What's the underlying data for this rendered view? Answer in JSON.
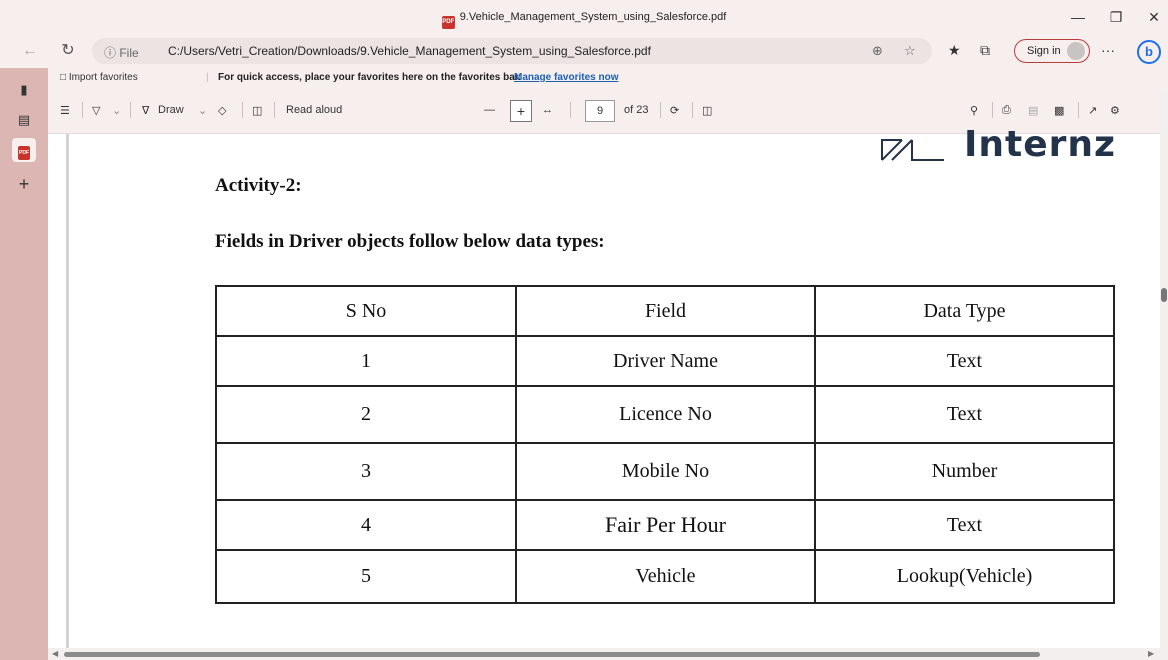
{
  "window": {
    "title": "9.Vehicle_Management_System_using_Salesforce.pdf",
    "pdf_badge": "PDF",
    "minimize_icon": "minimize-icon",
    "maximize_icon": "restore-icon",
    "close_icon": "close-icon"
  },
  "address_bar": {
    "info_label": "ⓘ File",
    "url": "C:/Users/Vetri_Creation/Downloads/9.Vehicle_Management_System_using_Salesforce.pdf",
    "sign_in_label": "Sign in",
    "more_label": "···",
    "copilot_label": "b"
  },
  "favorites_bar": {
    "import_label": "Import favorites",
    "hint": "For quick access, place your favorites here on the favorites bar.",
    "manage_link": "Manage favorites now"
  },
  "pdf_toolbar": {
    "draw_label": "Draw",
    "read_aloud_label": "Read aloud",
    "page_current": "9",
    "page_total": "of 23"
  },
  "document": {
    "logo_text": "Internz",
    "activity_heading": "Activity-2:",
    "fields_heading": "Fields in Driver objects follow below data types:",
    "table": {
      "headers": [
        "S No",
        "Field",
        "Data Type"
      ],
      "rows": [
        [
          "1",
          "Driver Name",
          "Text"
        ],
        [
          "2",
          "Licence No",
          "Text"
        ],
        [
          "3",
          "Mobile No",
          "Number"
        ],
        [
          "4",
          "Fair Per Hour",
          "Text"
        ],
        [
          "5",
          "Vehicle",
          "Lookup(Vehicle)"
        ]
      ]
    }
  },
  "colors": {
    "chrome_bg": "#f7efee",
    "sidebar_bg": "#dbb6b3",
    "pdf_red": "#c8342c",
    "link_blue": "#1a5fb4",
    "logo_navy": "#22334a"
  }
}
